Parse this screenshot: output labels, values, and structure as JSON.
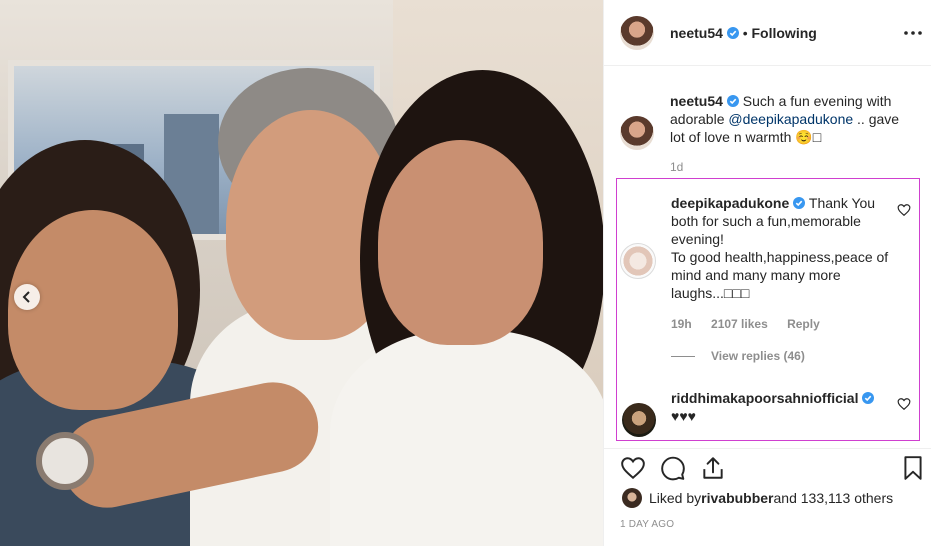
{
  "post": {
    "author": "neetu54",
    "follow_separator": "•",
    "follow_status": "Following",
    "caption_text_before": " Such a fun evening with adorable ",
    "caption_mention": "@deepikapadukone",
    "caption_text_after": " .. gave lot of love n warmth ☺️□",
    "caption_time": "1d",
    "liked_by_prefix": "Liked by ",
    "liked_by_user": "rivabubber",
    "liked_by_suffix": " and 133,113 others",
    "posted_time": "1 DAY AGO"
  },
  "comments": [
    {
      "username": "deepikapadukone",
      "text_line1": " Thank You",
      "text_rest": "both for such a fun,memorable evening!",
      "text_line3": "To good health,happiness,peace of mind and many many more laughs...□□□",
      "time": "19h",
      "likes": "2107 likes",
      "reply": "Reply",
      "view_replies": "View replies (46)"
    },
    {
      "username": "riddhimakapoorsahniofficial",
      "text": "♥♥♥"
    }
  ],
  "icons": {
    "verified": "verified-badge-icon",
    "more": "more-options-icon",
    "heart": "heart-icon",
    "comment": "comment-icon",
    "share": "share-icon",
    "save": "bookmark-icon",
    "carousel_prev": "chevron-left-icon"
  },
  "colors": {
    "verified_blue": "#3897f0",
    "mention": "#003569",
    "highlight": "#cf3fcf",
    "muted": "#8e8e8e"
  }
}
